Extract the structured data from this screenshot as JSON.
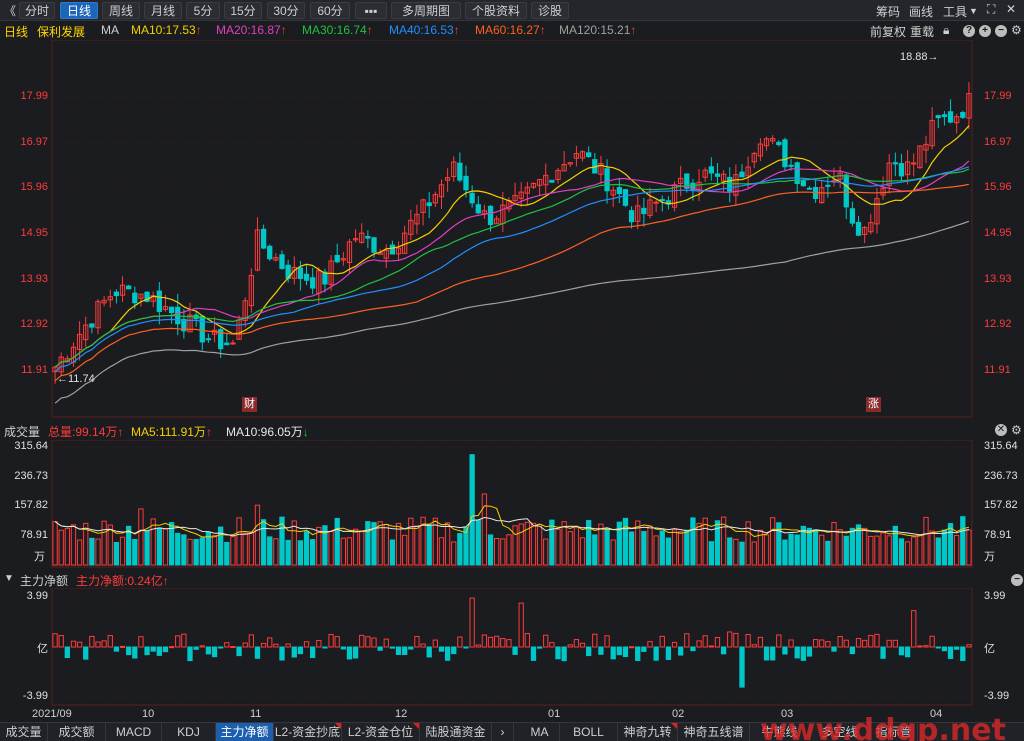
{
  "toolbar": {
    "back": "《",
    "tabs": [
      "分时",
      "日线",
      "周线",
      "月线",
      "5分",
      "15分",
      "30分",
      "60分",
      "▪▪▪",
      "多周期图",
      "个股资料",
      "诊股"
    ],
    "active": "日线",
    "right": [
      "筹码",
      "画线",
      "工具"
    ]
  },
  "info": {
    "period": "日线",
    "stock": "保利发展",
    "ma_label": "MA",
    "ma10": "MA10:17.53",
    "ma20": "MA20:16.87",
    "ma30": "MA30:16.74",
    "ma40": "MA40:16.53",
    "ma60": "MA60:16.27",
    "ma120": "MA120:15.21",
    "fq": "前复权",
    "cz": "重载"
  },
  "colors": {
    "up": "#ff3b3b",
    "down": "#00c8c8",
    "ma10": "#f5d000",
    "ma20": "#e040c0",
    "ma30": "#20c040",
    "ma40": "#2090ff",
    "ma60": "#ff6020",
    "ma120": "#a0a0a0",
    "grid": "#3a1a1a"
  },
  "price_axis": [
    "17.99",
    "16.97",
    "15.96",
    "14.95",
    "13.93",
    "12.92",
    "11.91"
  ],
  "price_marks": {
    "high": "18.88",
    "low": "11.74",
    "tag_cai": "财",
    "tag_zhang": "涨"
  },
  "volume": {
    "title": "成交量",
    "total": "总量:99.14万",
    "ma5": "MA5:111.91万",
    "ma10": "MA10:96.05万",
    "axis": [
      "315.64",
      "236.73",
      "157.82",
      "78.91",
      "万"
    ]
  },
  "mainflow": {
    "title": "主力净额",
    "value": "主力净额:0.24亿",
    "axis": [
      "3.99",
      "亿",
      "-3.99"
    ]
  },
  "dates": [
    "2021/09",
    "10",
    "11",
    "12",
    "01",
    "02",
    "03",
    "04"
  ],
  "tabs": [
    "成交量",
    "成交额",
    "MACD",
    "KDJ",
    "主力净额",
    "L2-资金抄底",
    "L2-资金仓位",
    "陆股通资金",
    "MA",
    "BOLL",
    "神奇九转",
    "神奇五线谱",
    "牛熊线",
    "多空线",
    "指标管理"
  ],
  "tabs_active": "主力净额",
  "watermark": "www.ddgp.net"
}
